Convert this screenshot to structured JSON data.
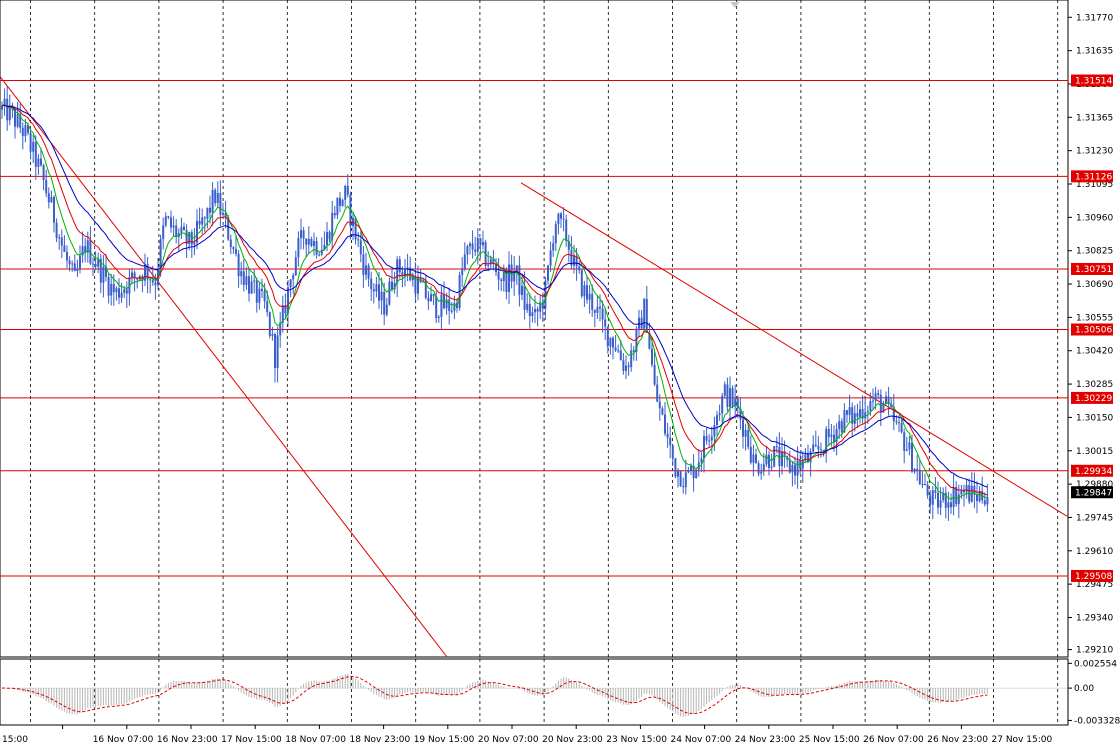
{
  "chart_data": {
    "type": "candlestick",
    "symbol_timeframe": "GBPUSD H1",
    "price_axis": {
      "ticks": [
        "1.31770",
        "1.31635",
        "1.31500",
        "1.31365",
        "1.31230",
        "1.31095",
        "1.30960",
        "1.30825",
        "1.30690",
        "1.30555",
        "1.30420",
        "1.30285",
        "1.30150",
        "1.30015",
        "1.29880",
        "1.29745",
        "1.29610",
        "1.29475",
        "1.29340",
        "1.29210"
      ],
      "ylim": [
        1.2918,
        1.3184
      ]
    },
    "time_axis": {
      "labels": [
        "15:00",
        "16 Nov 07:00",
        "16 Nov 23:00",
        "17 Nov 15:00",
        "18 Nov 07:00",
        "18 Nov 23:00",
        "19 Nov 15:00",
        "20 Nov 07:00",
        "20 Nov 23:00",
        "23 Nov 15:00",
        "24 Nov 07:00",
        "24 Nov 23:00",
        "25 Nov 15:00",
        "26 Nov 07:00",
        "26 Nov 23:00",
        "27 Nov 15:00"
      ]
    },
    "levels": [
      {
        "value": "1.31514",
        "price": 1.31514
      },
      {
        "value": "1.31126",
        "price": 1.31126
      },
      {
        "value": "1.30751",
        "price": 1.30751
      },
      {
        "value": "1.30506",
        "price": 1.30506
      },
      {
        "value": "1.30229",
        "price": 1.30229
      },
      {
        "value": "1.29934",
        "price": 1.29934
      },
      {
        "value": "1.29508",
        "price": 1.29508
      }
    ],
    "current_price": {
      "value": "1.29847",
      "price": 1.29847
    },
    "trendlines": [
      {
        "from": [
          0,
          1.3153
        ],
        "to": [
          447,
          1.2918
        ]
      },
      {
        "from": [
          521,
          1.311
        ],
        "to": [
          1067,
          1.2975
        ]
      }
    ],
    "price_anchors": [
      [
        0,
        1.314
      ],
      [
        10,
        1.3138
      ],
      [
        25,
        1.313
      ],
      [
        40,
        1.3115
      ],
      [
        55,
        1.3095
      ],
      [
        65,
        1.308
      ],
      [
        75,
        1.307
      ],
      [
        85,
        1.3085
      ],
      [
        100,
        1.3075
      ],
      [
        115,
        1.3065
      ],
      [
        130,
        1.307
      ],
      [
        145,
        1.3075
      ],
      [
        155,
        1.307
      ],
      [
        165,
        1.3095
      ],
      [
        175,
        1.309
      ],
      [
        190,
        1.3085
      ],
      [
        205,
        1.3095
      ],
      [
        215,
        1.3105
      ],
      [
        228,
        1.309
      ],
      [
        240,
        1.3075
      ],
      [
        255,
        1.3065
      ],
      [
        265,
        1.306
      ],
      [
        275,
        1.304
      ],
      [
        285,
        1.306
      ],
      [
        295,
        1.308
      ],
      [
        305,
        1.309
      ],
      [
        315,
        1.3085
      ],
      [
        325,
        1.3085
      ],
      [
        335,
        1.31
      ],
      [
        345,
        1.3105
      ],
      [
        355,
        1.309
      ],
      [
        365,
        1.3075
      ],
      [
        375,
        1.3065
      ],
      [
        385,
        1.306
      ],
      [
        395,
        1.3075
      ],
      [
        405,
        1.3075
      ],
      [
        415,
        1.307
      ],
      [
        425,
        1.3065
      ],
      [
        435,
        1.306
      ],
      [
        445,
        1.306
      ],
      [
        455,
        1.306
      ],
      [
        465,
        1.308
      ],
      [
        475,
        1.3085
      ],
      [
        485,
        1.308
      ],
      [
        495,
        1.3075
      ],
      [
        505,
        1.307
      ],
      [
        515,
        1.3075
      ],
      [
        525,
        1.306
      ],
      [
        535,
        1.3055
      ],
      [
        545,
        1.3065
      ],
      [
        555,
        1.3095
      ],
      [
        565,
        1.309
      ],
      [
        575,
        1.3075
      ],
      [
        585,
        1.3065
      ],
      [
        595,
        1.306
      ],
      [
        605,
        1.305
      ],
      [
        615,
        1.3045
      ],
      [
        625,
        1.3035
      ],
      [
        635,
        1.3045
      ],
      [
        645,
        1.306
      ],
      [
        655,
        1.3025
      ],
      [
        665,
        1.301
      ],
      [
        675,
        1.2995
      ],
      [
        685,
        1.299
      ],
      [
        695,
        1.2995
      ],
      [
        705,
        1.3005
      ],
      [
        715,
        1.3015
      ],
      [
        725,
        1.3025
      ],
      [
        735,
        1.302
      ],
      [
        745,
        1.301
      ],
      [
        755,
        1.2995
      ],
      [
        765,
        1.2998
      ],
      [
        775,
        1.3
      ],
      [
        785,
        1.2995
      ],
      [
        795,
        1.2995
      ],
      [
        805,
        1.2997
      ],
      [
        815,
        1.3
      ],
      [
        825,
        1.3005
      ],
      [
        835,
        1.301
      ],
      [
        845,
        1.3015
      ],
      [
        855,
        1.3015
      ],
      [
        865,
        1.302
      ],
      [
        875,
        1.3022
      ],
      [
        885,
        1.302
      ],
      [
        895,
        1.3012
      ],
      [
        905,
        1.3005
      ],
      [
        915,
        1.2995
      ],
      [
        925,
        1.2985
      ],
      [
        935,
        1.298
      ],
      [
        945,
        1.2982
      ],
      [
        955,
        1.2984
      ],
      [
        965,
        1.2985
      ],
      [
        975,
        1.2983
      ],
      [
        985,
        1.2984
      ],
      [
        990,
        1.2985
      ]
    ],
    "oscillator": {
      "ticks": [
        "0.002554",
        "0.00",
        "-0.003328"
      ],
      "ylim": [
        -0.0038,
        0.003
      ]
    }
  }
}
